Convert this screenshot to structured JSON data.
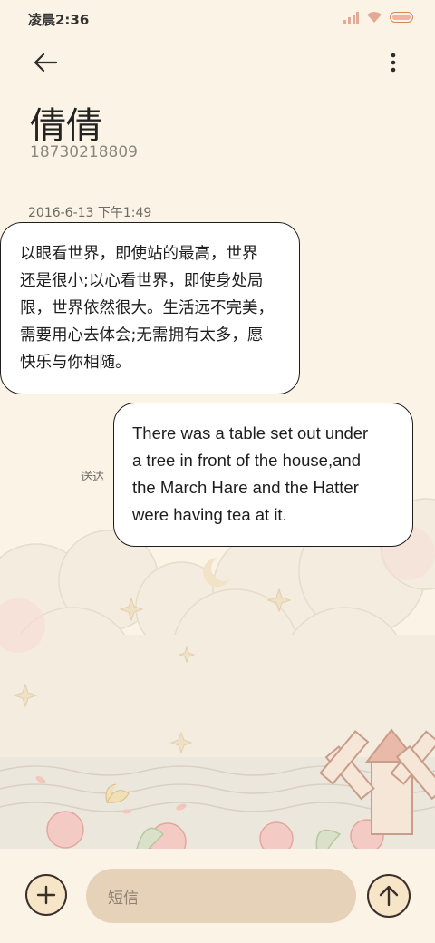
{
  "status_bar": {
    "time": "凌晨2:36",
    "icons": [
      "signal-icon",
      "wifi-icon",
      "battery-icon"
    ]
  },
  "header": {
    "back_icon": "arrow-left-icon",
    "menu_icon": "more-vertical-icon",
    "contact_name": "倩倩",
    "contact_number": "18730218809"
  },
  "conversation": {
    "timestamp": "2016-6-13 下午1:49",
    "messages": [
      {
        "direction": "incoming",
        "lines": [
          "以眼看世界，即使站的最高，世界",
          "还是很小;以心看世界，即使身处局",
          "限，世界依然很大。生活远不完美，",
          "需要用心去体会;无需拥有太多，愿",
          "快乐与你相随。"
        ]
      },
      {
        "direction": "outgoing",
        "status": "送达",
        "lines": [
          "There was a table set out under",
          "a tree in front of the house,and",
          "the March Hare and the Hatter",
          "were having tea at it."
        ]
      }
    ]
  },
  "composer": {
    "add_icon": "plus-icon",
    "placeholder": "短信",
    "send_icon": "arrow-up-icon"
  },
  "colors": {
    "background": "#fbf3e6",
    "bubble": "#ffffff",
    "bubble_border": "#1d1d1d",
    "input_field": "#e5d2b8",
    "button_fill": "#f7e5c8",
    "battery": "#d08a5a"
  }
}
